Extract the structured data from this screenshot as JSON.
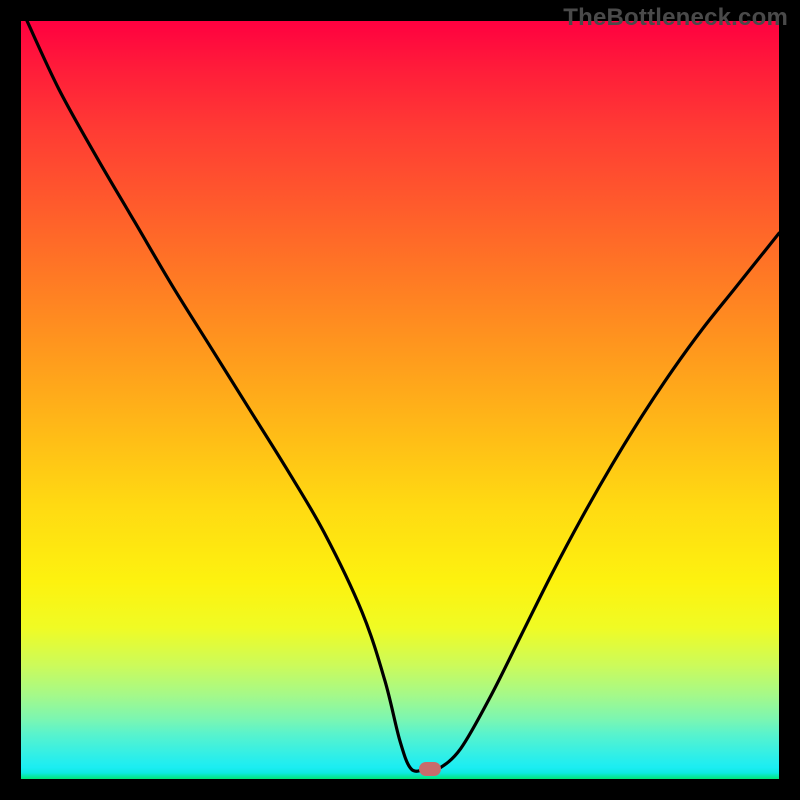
{
  "watermark": "TheBottleneck.com",
  "chart_data": {
    "type": "line",
    "title": "",
    "xlabel": "",
    "ylabel": "",
    "xlim": [
      0,
      100
    ],
    "ylim": [
      0,
      100
    ],
    "series": [
      {
        "name": "curve",
        "x": [
          0.8,
          5,
          10,
          15,
          20,
          25,
          30,
          35,
          40,
          45,
          48,
          50,
          51.5,
          53.5,
          55,
          58,
          62,
          66,
          70,
          74,
          78,
          82,
          86,
          90,
          94,
          98,
          100
        ],
        "y": [
          100,
          91,
          82,
          73.5,
          65,
          57,
          49,
          41,
          32.5,
          22,
          13,
          5,
          1.3,
          1.3,
          1.3,
          4,
          11,
          19,
          27,
          34.5,
          41.5,
          48,
          54,
          59.5,
          64.5,
          69.5,
          72
        ]
      }
    ],
    "marker": {
      "x": 54,
      "y": 1.3
    },
    "colors": {
      "curve": "#000000",
      "marker": "#c96b6b",
      "frame": "#000000",
      "gradient_top": "#ff0040",
      "gradient_bottom": "#00e676"
    }
  }
}
